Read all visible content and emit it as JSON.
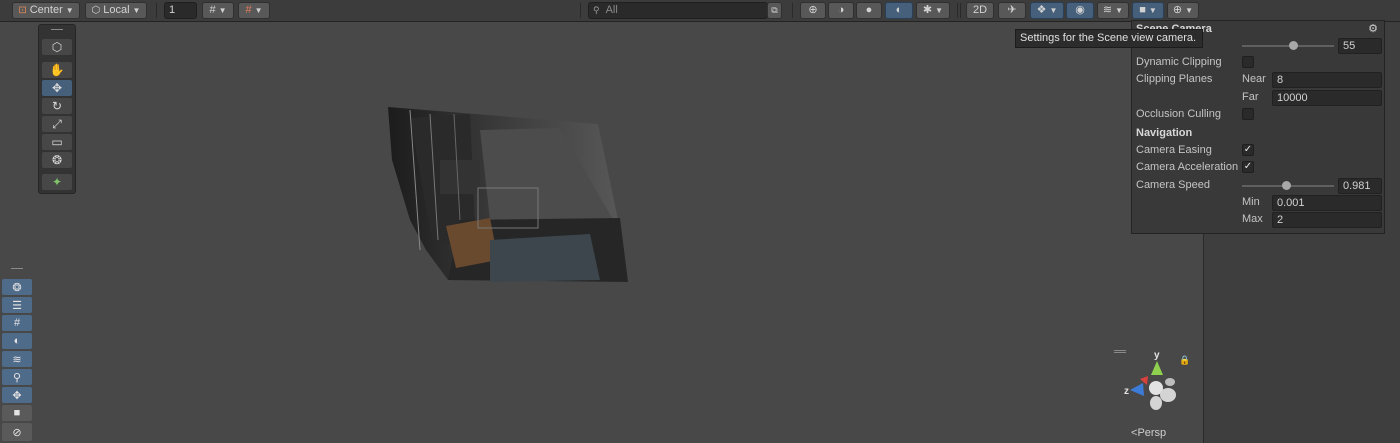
{
  "toolbar": {
    "pivot_mode": "Center",
    "pivot_rotation": "Local",
    "grid_size": "1",
    "search_placeholder": "All",
    "scene_2d_label": "2D"
  },
  "tooltip": "Settings for the Scene view camera.",
  "camera_panel": {
    "title": "Scene Camera",
    "field_of_view_value": "55",
    "field_of_view_level": 0.55,
    "dynamic_clipping_label": "Dynamic Clipping",
    "dynamic_clipping_checked": false,
    "clipping_planes_label": "Clipping Planes",
    "near_label": "Near",
    "near_value": "8",
    "far_label": "Far",
    "far_value": "10000",
    "occlusion_culling_label": "Occlusion Culling",
    "occlusion_culling_checked": false,
    "navigation_label": "Navigation",
    "camera_easing_label": "Camera Easing",
    "camera_easing_mark": "✓",
    "camera_acceleration_label": "Camera Acceleration",
    "camera_acceleration_mark": "✓",
    "camera_speed_label": "Camera Speed",
    "camera_speed_value": "0.981",
    "camera_speed_level": 0.48,
    "min_label": "Min",
    "min_value": "0.001",
    "max_label": "Max",
    "max_value": "2"
  },
  "gizmo": {
    "y_label": "y",
    "z_label": "z",
    "projection_label": "Persp"
  },
  "colors": {
    "accent": "#46607c",
    "gizmo_y": "#8fd14f",
    "gizmo_z": "#3d7bd9",
    "gizmo_x": "#d9413d"
  },
  "icons": {
    "tools": [
      "view-tool-icon",
      "hand-tool-icon",
      "move-tool-icon",
      "rotate-tool-icon",
      "scale-tool-icon",
      "rect-tool-icon",
      "transform-tool-icon",
      "custom-tool-icon"
    ],
    "overlays": [
      "overlay-orientation-icon",
      "overlay-grid-icon",
      "overlay-snap-icon",
      "overlay-lighting-icon",
      "overlay-layers-icon",
      "overlay-search-icon",
      "overlay-move-icon",
      "overlay-camera-icon",
      "overlay-navigation-icon"
    ]
  }
}
